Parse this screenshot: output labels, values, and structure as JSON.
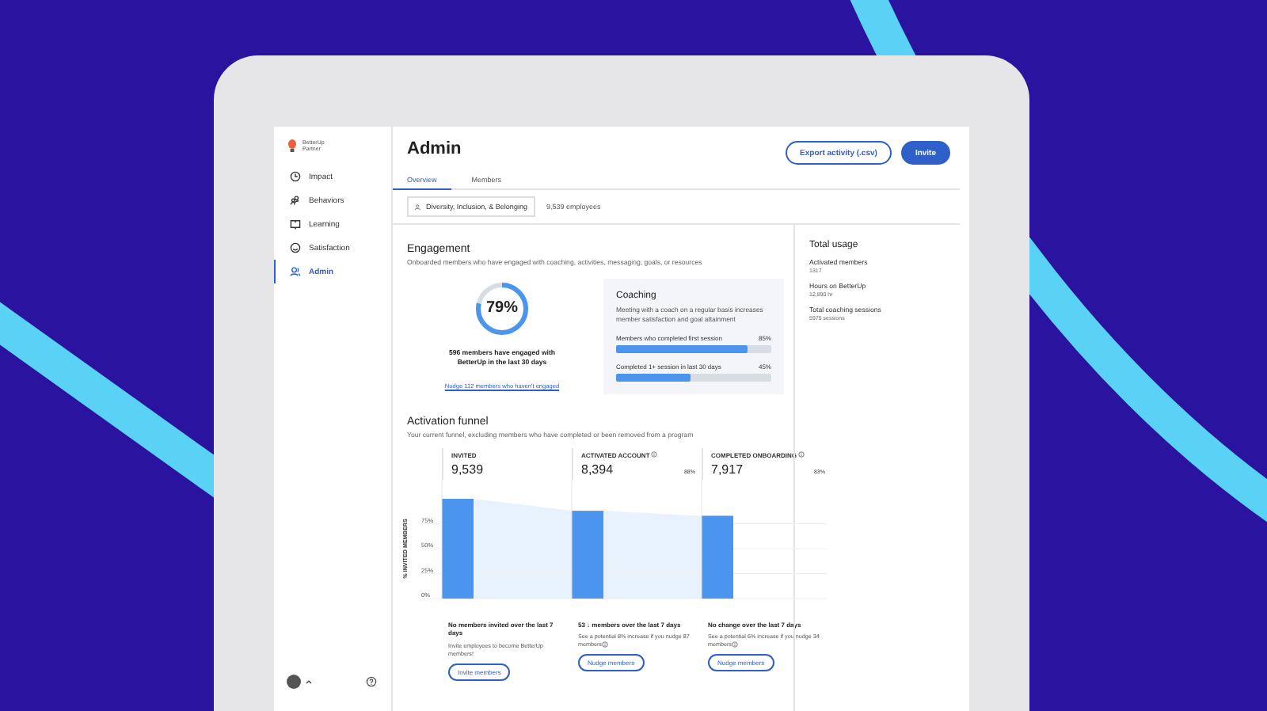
{
  "sidebar": {
    "logo": [
      "BetterUp",
      "Partner"
    ],
    "items": [
      {
        "label": "Impact",
        "selected": false
      },
      {
        "label": "Behaviors",
        "selected": false
      },
      {
        "label": "Learning",
        "selected": false
      },
      {
        "label": "Satisfaction",
        "selected": false
      },
      {
        "label": "Admin",
        "selected": true
      }
    ]
  },
  "header": {
    "title": "Admin",
    "tabs": [
      {
        "label": "Overview",
        "selected": true
      },
      {
        "label": "Members",
        "selected": false
      }
    ],
    "buttons": [
      {
        "label": "Export activity (.csv)",
        "kind": "outline"
      },
      {
        "label": "Invite",
        "kind": "filled"
      }
    ],
    "filter": "Diversity, Inclusion, & Belonging",
    "employees": "9,539 employees"
  },
  "engagement": {
    "title": "Engagement",
    "subtitle": "Onboarded members who have engaged with coaching, activities, messaging, goals, or resources",
    "donut": {
      "level": 0.79,
      "value": "79%"
    },
    "summary": "596 members have engaged with BetterUp in the last 30 days",
    "link": "Nudge 112 members who haven't engaged",
    "coaching": {
      "title": "Coaching",
      "text": "Meeting with a coach on a regular basis increases member satisfaction and goal attainment",
      "bars": [
        {
          "label": "Members who completed first session",
          "reading": "85%",
          "level": 0.85
        },
        {
          "label": "Completed 1+ session in last 30 days",
          "reading": "45%",
          "level": 0.48
        }
      ]
    }
  },
  "usage": {
    "title": "Total usage",
    "items": [
      {
        "label": "Activated members",
        "value": "1317"
      },
      {
        "label": "Hours on BetterUp",
        "value": "12,890 hr"
      },
      {
        "label": "Total coaching sessions",
        "value": "5975 sessions"
      }
    ]
  },
  "funnel": {
    "title": "Activation funnel",
    "subtitle": "Your current funnel, excluding members who have completed or been removed from a program",
    "stages": [
      {
        "label": "INVITED",
        "value": "9,539",
        "info": false,
        "headline": "No members invited over the last 7 days",
        "note": "Invite employees to become BetterUp members!",
        "note_info": false,
        "button": "Invite members"
      },
      {
        "label": "ACTIVATED ACCOUNT",
        "value": "8,394",
        "percent": "88%",
        "info": true,
        "headline": "53 ↓ members over the last 7 days",
        "note": "See a potential 8% increase if you nudge 87 members",
        "note_info": true,
        "button": "Nudge members"
      },
      {
        "label": "COMPLETED ONBOARDING",
        "value": "7,917",
        "percent": "83%",
        "info": true,
        "headline": "No change over the last 7 days",
        "note": "See a potential 6% increase if you nudge 34 members",
        "note_info": true,
        "button": "Nudge members"
      }
    ],
    "chart_data": {
      "type": "bar",
      "ylabel": "% INVITED MEMBERS",
      "values": [
        100,
        88,
        83
      ],
      "ylim": [
        0,
        100
      ],
      "grid": true,
      "yticks": [
        {
          "value": 0,
          "label": "0%"
        },
        {
          "value": 25,
          "label": "25%"
        },
        {
          "value": 50,
          "label": "50%"
        },
        {
          "value": 75,
          "label": "75%"
        }
      ]
    }
  }
}
